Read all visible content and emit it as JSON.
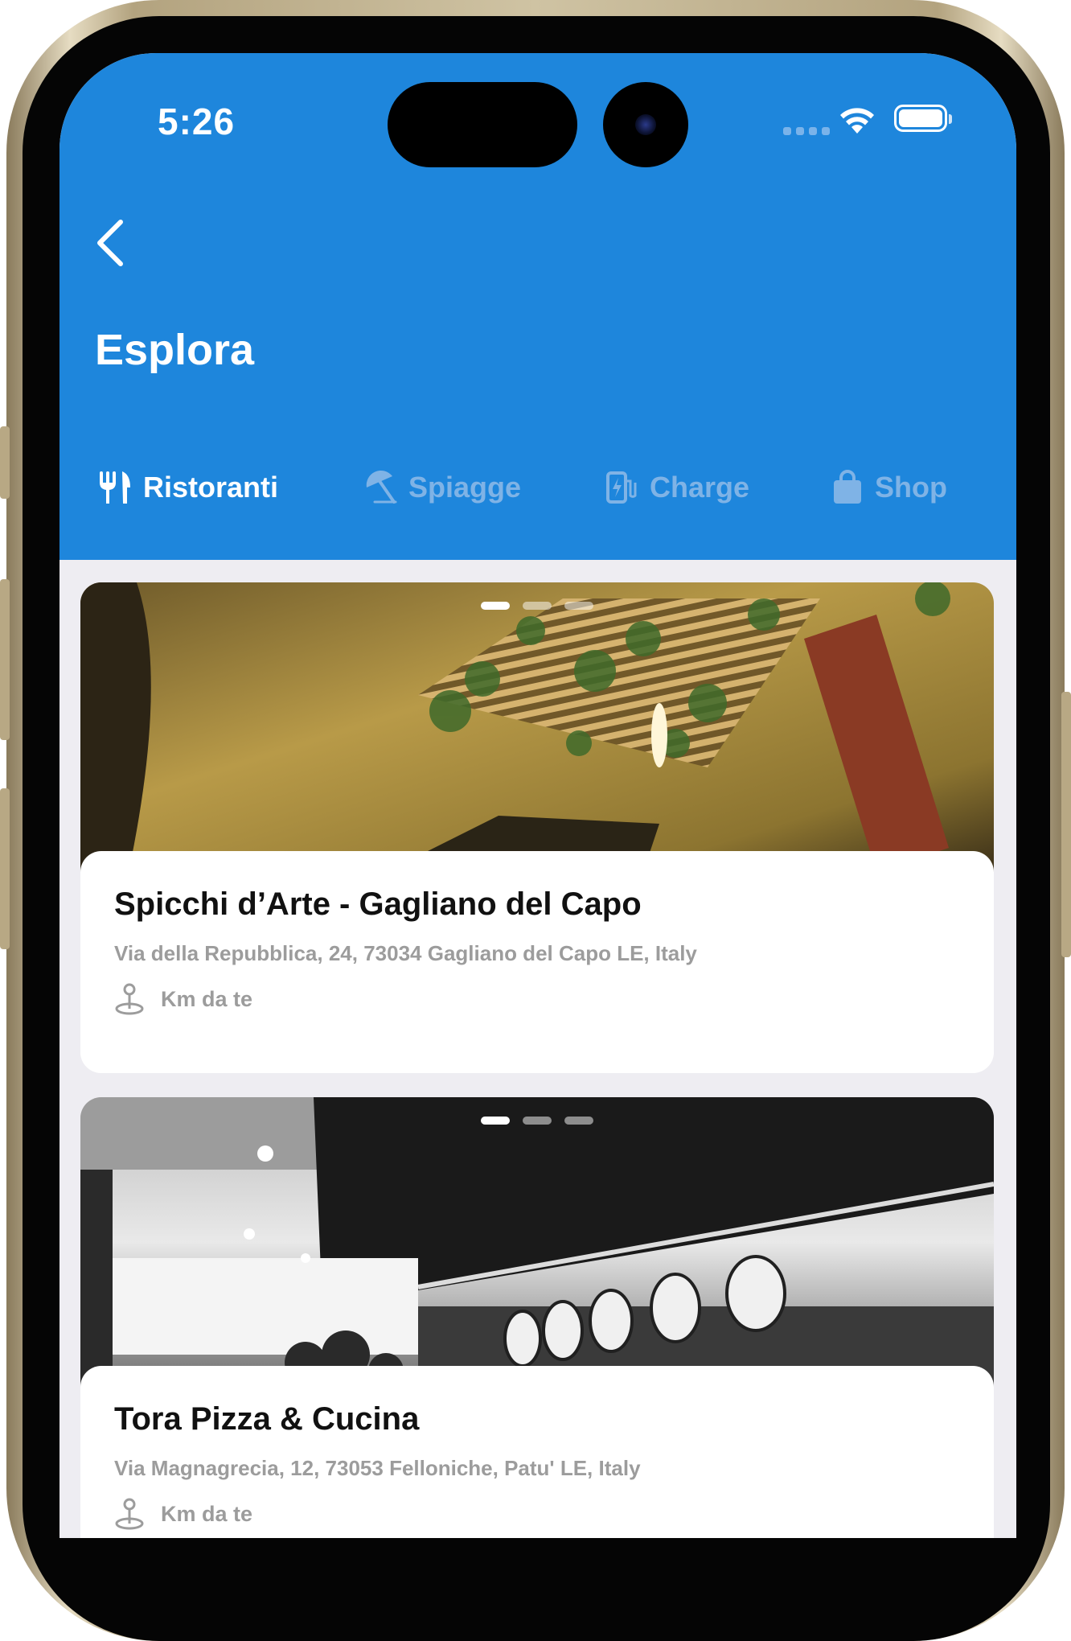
{
  "status_bar": {
    "time": "5:26"
  },
  "header": {
    "title": "Esplora",
    "back_icon": "chevron-left-icon"
  },
  "colors": {
    "accent": "#1E86DC",
    "tab_inactive": "#7FB3E6",
    "background": "#EEEDF2"
  },
  "tabs": [
    {
      "label": "Ristoranti",
      "icon": "fork-knife-icon",
      "active": true
    },
    {
      "label": "Spiagge",
      "icon": "beach-umbrella-icon",
      "active": false
    },
    {
      "label": "Charge",
      "icon": "ev-charger-icon",
      "active": false
    },
    {
      "label": "Shop",
      "icon": "shopping-bag-icon",
      "active": false
    }
  ],
  "places": [
    {
      "name": "Spicchi d’Arte - Gagliano del Capo",
      "address": "Via della Repubblica, 24, 73034 Gagliano del Capo LE, Italy",
      "distance_label": "Km da te",
      "carousel_pages": 3,
      "carousel_active": 1
    },
    {
      "name": "Tora Pizza & Cucina",
      "address": "Via Magnagrecia, 12, 73053 Felloniche, Patu' LE, Italy",
      "distance_label": "Km da te",
      "carousel_pages": 3,
      "carousel_active": 1
    }
  ]
}
